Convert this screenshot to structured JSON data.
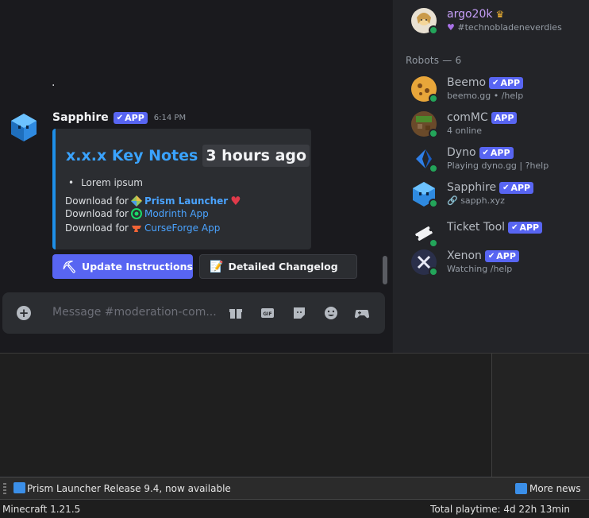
{
  "chat": {
    "dot_text": ".",
    "message": {
      "author": "Sapphire",
      "badge": "APP",
      "time": "6:14 PM",
      "embed": {
        "title_main": "x.x.x Key Notes",
        "title_time": "3 hours ago",
        "bullet": "Lorem ipsum",
        "downloads": [
          {
            "prefix": "Download for",
            "link": "Prism Launcher",
            "suffix_icon": "heart-icon"
          },
          {
            "prefix": "Download for",
            "link": "Modrinth App"
          },
          {
            "prefix": "Download for",
            "link": "CurseForge App"
          }
        ]
      },
      "buttons": {
        "update": "Update Instructions",
        "changelog": "Detailed Changelog"
      }
    },
    "composer": {
      "placeholder": "Message #moderation-com..."
    }
  },
  "members": {
    "top_user": {
      "name": "argo20k",
      "status": "#technobladeneverdies"
    },
    "group_header": "Robots — 6",
    "robots": [
      {
        "name": "Beemo",
        "badge": "APP",
        "sub": "beemo.gg • /help"
      },
      {
        "name": "comMC",
        "badge": "APP",
        "sub": "4 online"
      },
      {
        "name": "Dyno",
        "badge": "APP",
        "sub": "Playing dyno.gg | ?help"
      },
      {
        "name": "Sapphire",
        "badge": "APP",
        "sub": "sapph.xyz"
      },
      {
        "name": "Ticket Tool",
        "badge": "APP",
        "sub": ""
      },
      {
        "name": "Xenon",
        "badge": "APP",
        "sub": "Watching /help"
      }
    ]
  },
  "news": {
    "headline": "Prism Launcher Release 9.4, now available",
    "more": "More news"
  },
  "statusbar": {
    "instance": "Minecraft 1.21.5",
    "playtime": "Total playtime: 4d 22h 13min"
  },
  "colors": {
    "blurple": "#5865f2",
    "link": "#4aa3ff",
    "online": "#23a55a",
    "embed_border": "#1e8fe8"
  }
}
